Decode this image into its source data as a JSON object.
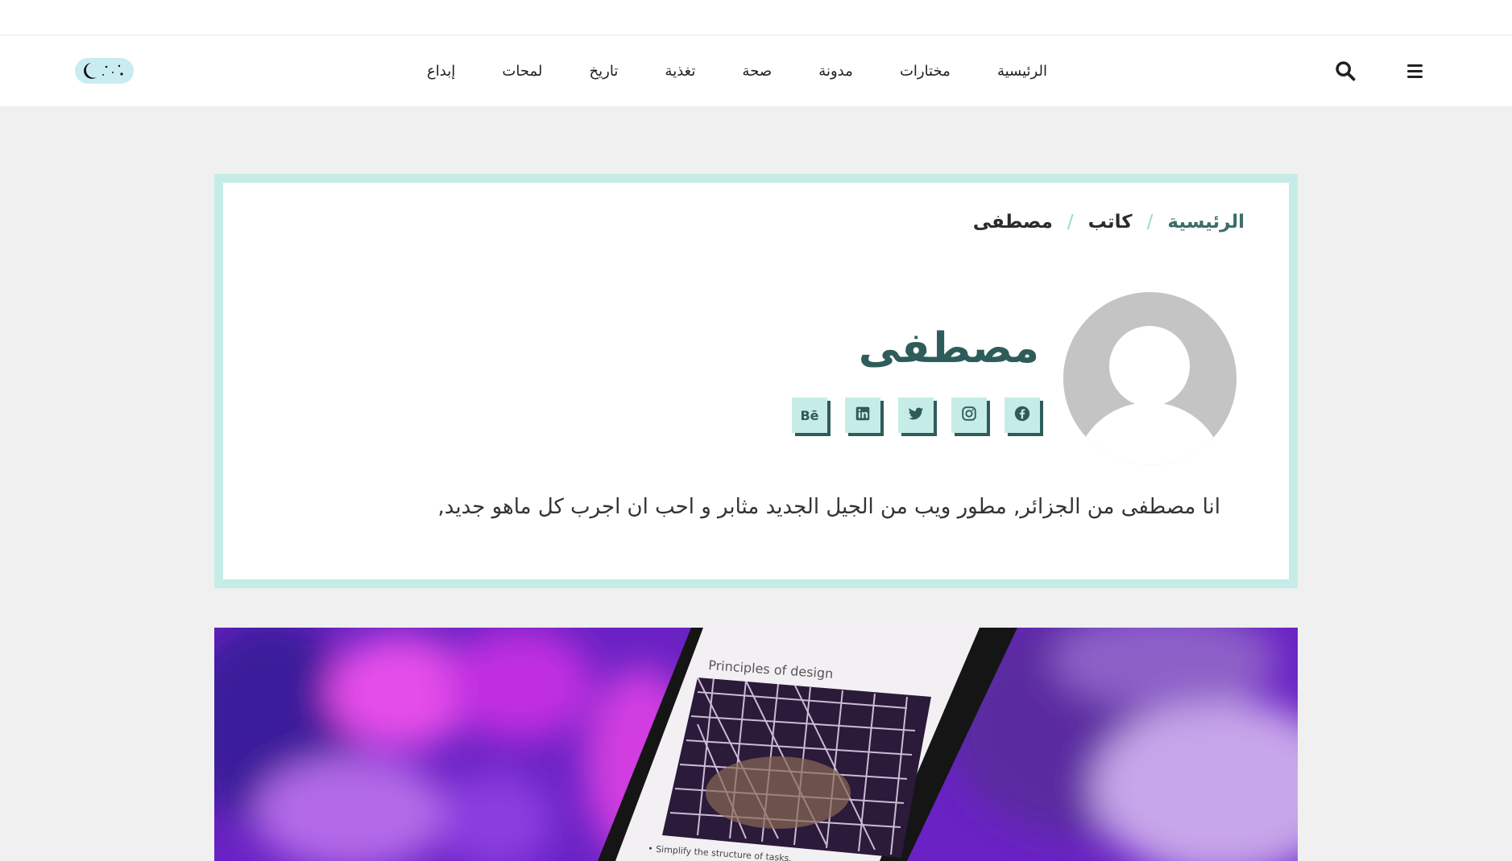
{
  "header": {
    "nav": [
      {
        "label": "الرئيسية"
      },
      {
        "label": "مختارات"
      },
      {
        "label": "مدونة"
      },
      {
        "label": "صحة"
      },
      {
        "label": "تغذية"
      },
      {
        "label": "تاريخ"
      },
      {
        "label": "لمحات"
      },
      {
        "label": "إبداع"
      }
    ],
    "icons": {
      "menu": "menu-icon",
      "search": "search-icon",
      "theme": "dark-mode-toggle"
    }
  },
  "breadcrumb": {
    "home": "الرئيسية",
    "separator": "/",
    "section": "كاتب",
    "current": "مصطفى"
  },
  "author": {
    "name": "مصطفى",
    "bio": "انا مصطفى من الجزائر, مطور ويب من الجيل الجديد مثابر و احب ان اجرب كل ماهو جديد,",
    "socials": [
      {
        "icon": "facebook-icon"
      },
      {
        "icon": "instagram-icon"
      },
      {
        "icon": "twitter-icon"
      },
      {
        "icon": "linkedin-icon"
      },
      {
        "icon": "behance-icon",
        "label": "Bē"
      }
    ]
  },
  "feature_image": {
    "heading": "Principles of design",
    "bullet": "• Simplify the structure of tasks."
  },
  "colors": {
    "accent": "#c6ece7",
    "brand_dark": "#2e5c5a",
    "page_bg": "#f0f0f0"
  }
}
